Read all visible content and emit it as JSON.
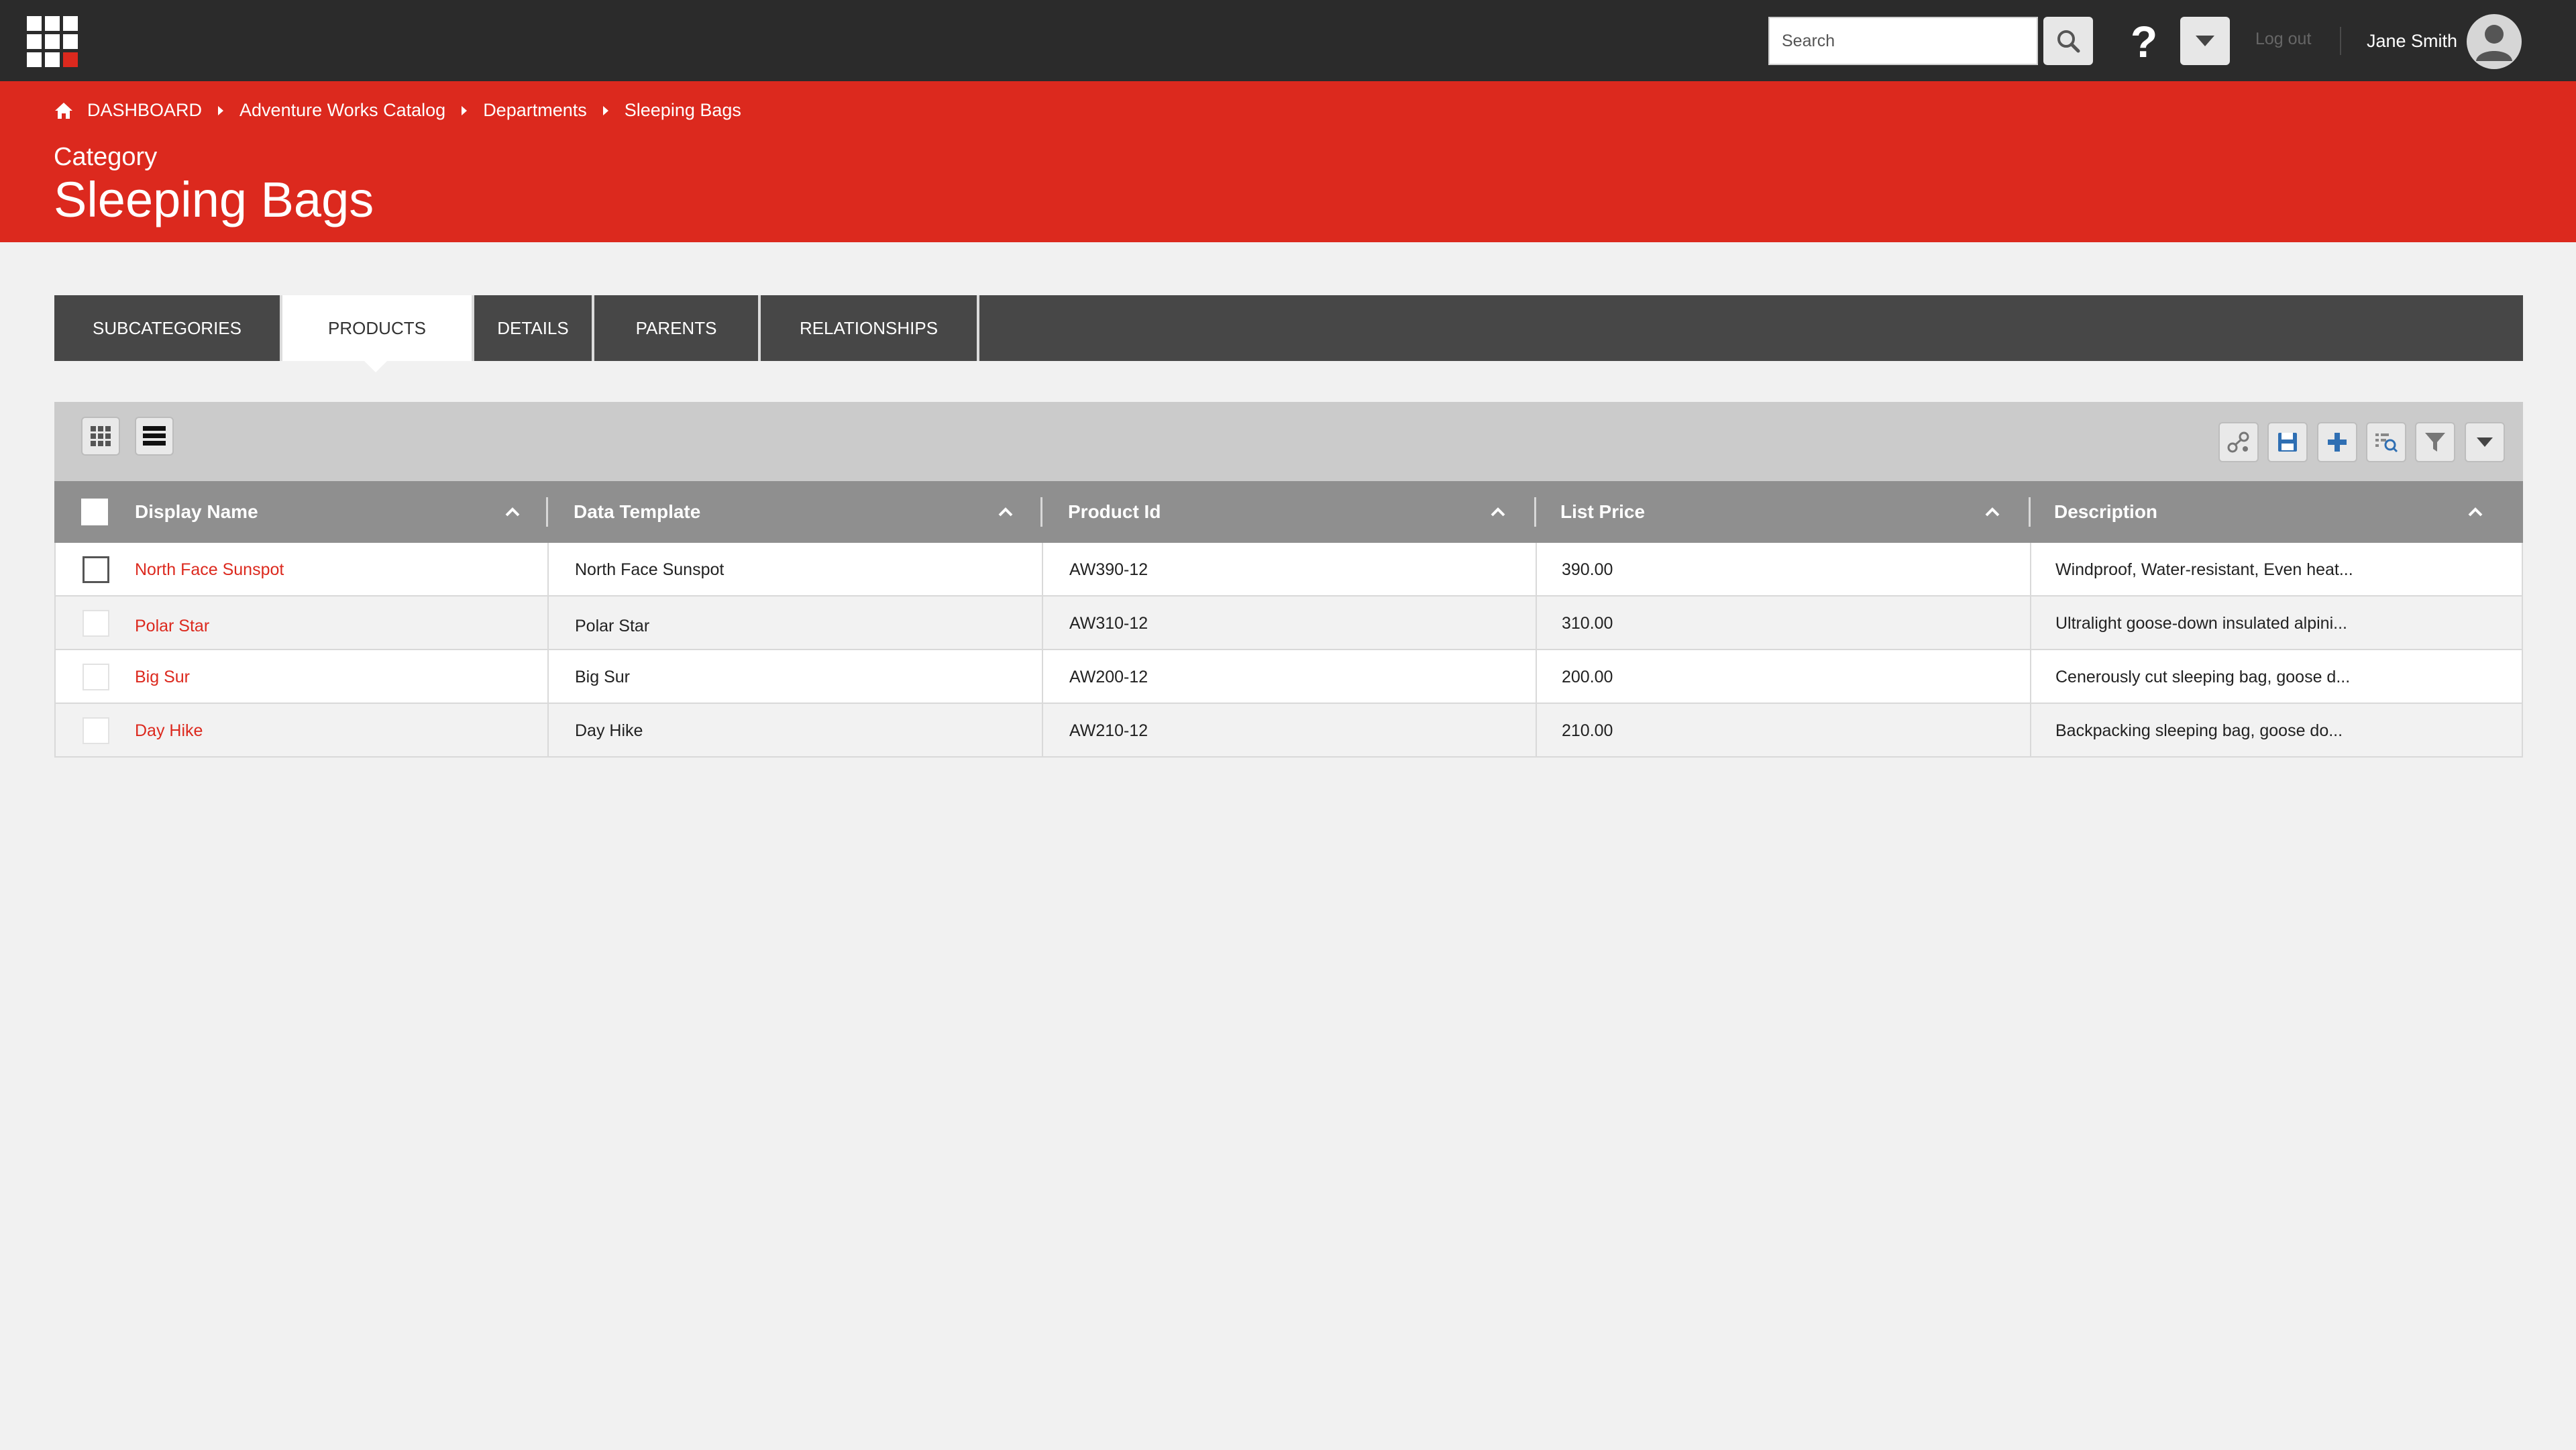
{
  "topbar": {
    "search_placeholder": "Search",
    "help_label": "?",
    "logout_label": "Log out",
    "user_name": "Jane Smith"
  },
  "header": {
    "breadcrumb": [
      "DASHBOARD",
      "Adventure Works Catalog",
      "Departments",
      "Sleeping Bags"
    ],
    "kicker": "Category",
    "title": "Sleeping Bags"
  },
  "tabs": [
    {
      "label": "SUBCATEGORIES",
      "active": false
    },
    {
      "label": "PRODUCTS",
      "active": true
    },
    {
      "label": "DETAILS",
      "active": false
    },
    {
      "label": "PARENTS",
      "active": false
    },
    {
      "label": "RELATIONSHIPS",
      "active": false
    }
  ],
  "toolbar": {
    "left_icons": [
      "tile-view-icon",
      "list-view-icon"
    ],
    "right_icons": [
      "relations-icon",
      "save-icon",
      "add-icon",
      "search-list-icon",
      "filter-icon",
      "more-dropdown-icon"
    ]
  },
  "grid": {
    "columns": [
      "Display Name",
      "Data Template",
      "Product Id",
      "List Price",
      "Description"
    ],
    "rows": [
      {
        "name": "North Face Sunspot",
        "template": "North Face Sunspot",
        "product_id": "AW390-12",
        "price": "390.00",
        "description": "Windproof, Water-resistant, Even heat..."
      },
      {
        "name": "Polar Star",
        "template": "Polar Star",
        "product_id": "AW310-12",
        "price": "310.00",
        "description": "Ultralight goose-down insulated alpini..."
      },
      {
        "name": "Big Sur",
        "template": "Big Sur",
        "product_id": "AW200-12",
        "price": "200.00",
        "description": "Cenerously cut sleeping bag, goose d..."
      },
      {
        "name": "Day Hike",
        "template": "Day Hike",
        "product_id": "AW210-12",
        "price": "210.00",
        "description": "Backpacking sleeping bag, goose do..."
      }
    ]
  },
  "colors": {
    "brand_red": "#dc291e",
    "topbar": "#2b2b2b",
    "tabbar": "#474747",
    "grid_header": "#8f8f8f"
  }
}
